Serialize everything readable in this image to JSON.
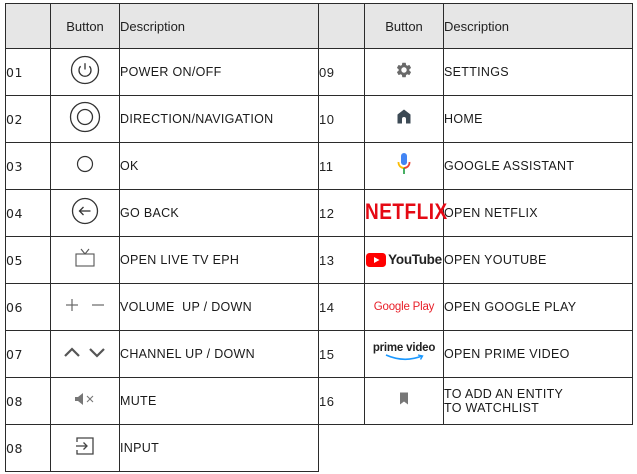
{
  "headers": {
    "blank": "",
    "button": "Button",
    "description": "Description"
  },
  "rows": [
    {
      "left": {
        "num": "01",
        "icon": "power-icon",
        "desc": "POWER ON/OFF"
      },
      "right": {
        "num": "09",
        "icon": "gear-icon",
        "desc": "SETTINGS"
      }
    },
    {
      "left": {
        "num": "02",
        "icon": "direction-pad-icon",
        "desc": "DIRECTION/NAVIGATION"
      },
      "right": {
        "num": "10",
        "icon": "home-icon",
        "desc": "HOME"
      }
    },
    {
      "left": {
        "num": "03",
        "icon": "ok-circle-icon",
        "desc": "OK"
      },
      "right": {
        "num": "11",
        "icon": "google-assistant-mic-icon",
        "desc": "GOOGLE ASSISTANT"
      }
    },
    {
      "left": {
        "num": "04",
        "icon": "back-arrow-icon",
        "desc": "GO BACK"
      },
      "right": {
        "num": "12",
        "icon": "netflix-logo",
        "logo_text": "NETFLIX",
        "desc": "OPEN NETFLIX"
      }
    },
    {
      "left": {
        "num": "05",
        "icon": "live-tv-icon",
        "desc": "OPEN LIVE TV EPH"
      },
      "right": {
        "num": "13",
        "icon": "youtube-logo",
        "logo_text": "YouTube",
        "desc": "OPEN YOUTUBE"
      }
    },
    {
      "left": {
        "num": "06",
        "icon": "volume-plus-minus-icon",
        "desc": "VOLUME  UP / DOWN"
      },
      "right": {
        "num": "14",
        "icon": "google-play-logo",
        "logo_text": "Google Play",
        "desc": "OPEN GOOGLE PLAY"
      }
    },
    {
      "left": {
        "num": "07",
        "icon": "channel-up-down-icon",
        "desc": "CHANNEL UP / DOWN"
      },
      "right": {
        "num": "15",
        "icon": "prime-video-logo",
        "logo_text": "prime video",
        "desc": "OPEN PRIME VIDEO"
      }
    },
    {
      "left": {
        "num": "08",
        "icon": "mute-icon",
        "desc": "MUTE"
      },
      "right": {
        "num": "16",
        "icon": "bookmark-icon",
        "desc_line1": "TO ADD AN ENTITY",
        "desc_line2": "TO WATCHLIST"
      }
    },
    {
      "left": {
        "num": "08",
        "icon": "input-icon",
        "desc": "INPUT"
      },
      "right": null
    }
  ],
  "colors": {
    "header_bg": "#e6e6e6",
    "border": "#2b2b2b",
    "icon_gray": "#555555",
    "netflix_red": "#e50914",
    "youtube_red": "#ff0000",
    "google_play_red": "#e8202a",
    "assistant_blue": "#4285f4",
    "assistant_red": "#ea4335",
    "assistant_yellow": "#fbbc05",
    "assistant_green": "#34a853",
    "prime_blue": "#1a98ff"
  }
}
